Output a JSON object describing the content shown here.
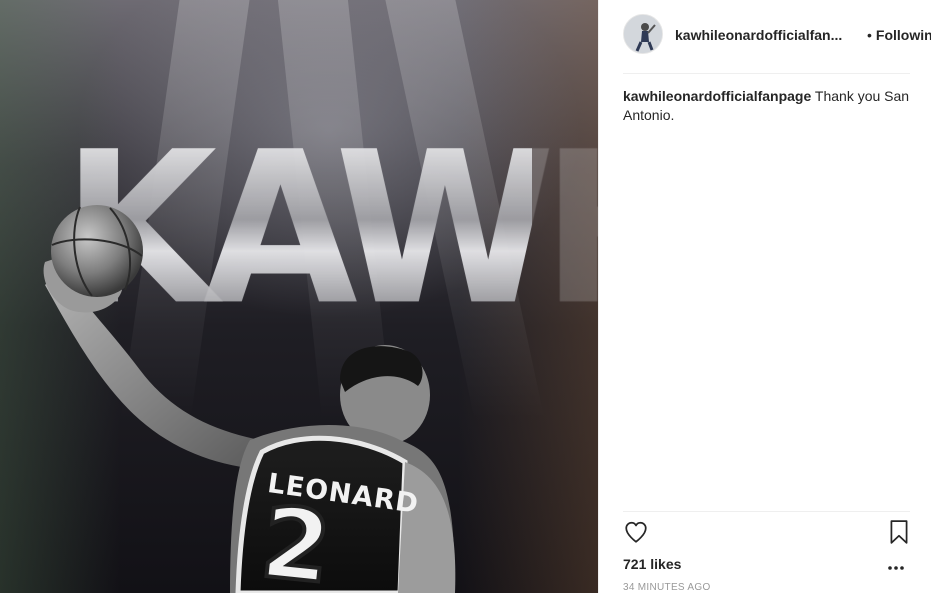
{
  "post": {
    "image_alt": "Kawhi Leonard holding basketball",
    "art_title": "KAWHI",
    "jersey_name": "LEONARD",
    "jersey_number": "2"
  },
  "header": {
    "username": "kawhileonardofficialfan...",
    "separator": "•",
    "follow_label": "Following"
  },
  "caption": {
    "username": "kawhileonardofficialfanpage",
    "text": "Thank you San Antonio."
  },
  "actions": {
    "like_icon": "heart-icon",
    "save_icon": "bookmark-icon",
    "more_icon": "more-options-icon"
  },
  "likes": {
    "label": "721 likes"
  },
  "timestamp": {
    "label": "34 minutes ago"
  }
}
